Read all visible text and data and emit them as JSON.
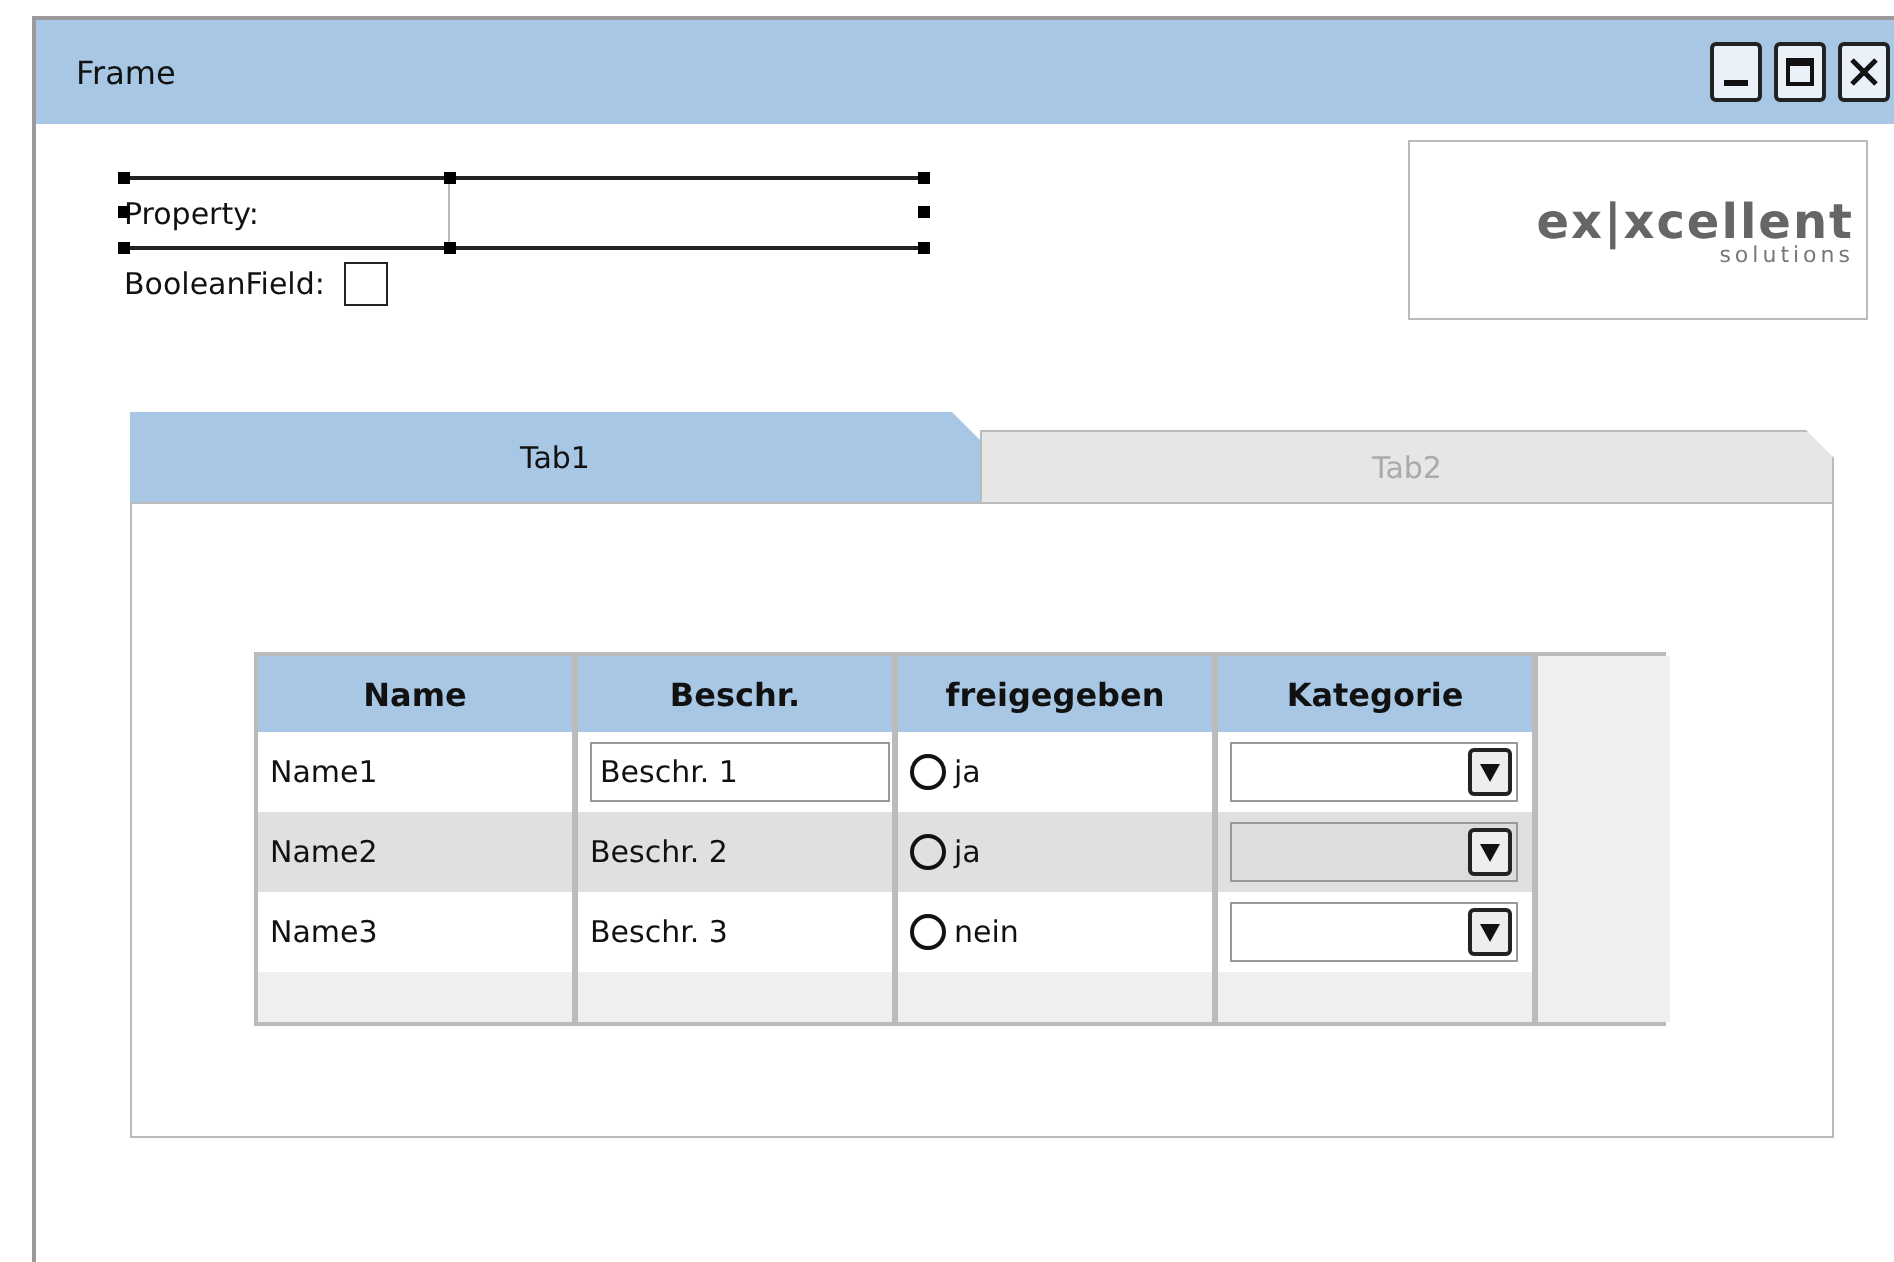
{
  "window": {
    "title": "Frame"
  },
  "form": {
    "property_label": "Property:",
    "boolean_label": "BooleanField:",
    "boolean_checked": false
  },
  "logo": {
    "main": "ex|xcellent",
    "sub": "solutions"
  },
  "tabs": [
    {
      "label": "Tab1",
      "selected": true
    },
    {
      "label": "Tab2",
      "selected": false
    }
  ],
  "table": {
    "columns": [
      "Name",
      "Beschr.",
      "freigegeben",
      "Kategorie"
    ],
    "rows": [
      {
        "name": "Name1",
        "beschr": "Beschr. 1",
        "beschr_editing": true,
        "radio_label": "ja",
        "radio_checked": false,
        "kategorie_disabled": false,
        "selected": false
      },
      {
        "name": "Name2",
        "beschr": "Beschr. 2",
        "beschr_editing": false,
        "radio_label": "ja",
        "radio_checked": false,
        "kategorie_disabled": true,
        "selected": true
      },
      {
        "name": "Name3",
        "beschr": "Beschr. 3",
        "beschr_editing": false,
        "radio_label": "nein",
        "radio_checked": false,
        "kategorie_disabled": false,
        "selected": false
      }
    ]
  }
}
